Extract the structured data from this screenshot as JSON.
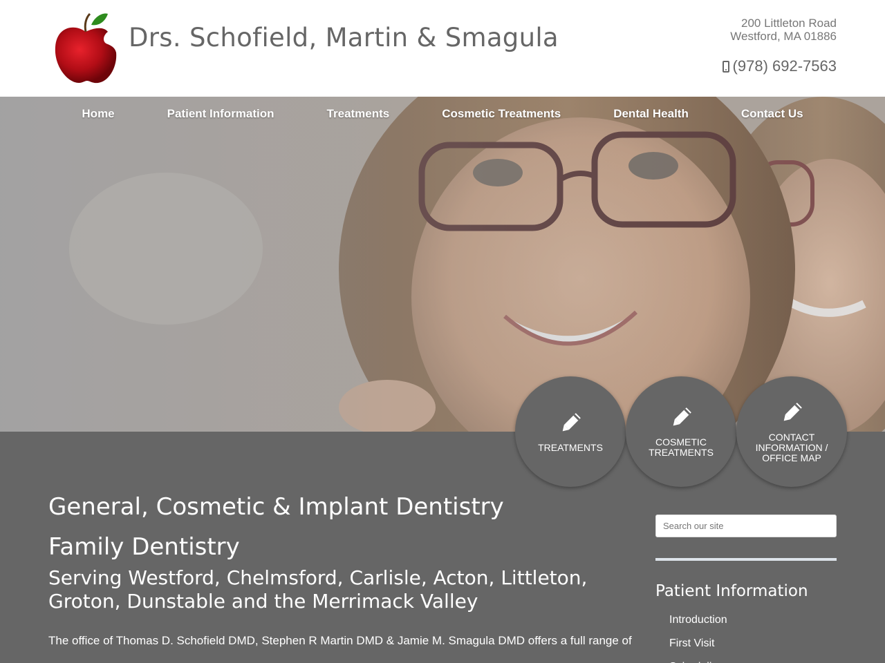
{
  "header": {
    "title": "Drs. Schofield, Martin & Smagula",
    "address_line1": "200 Littleton Road",
    "address_line2": "Westford, MA 01886",
    "phone": "(978) 692-7563"
  },
  "nav": {
    "items": [
      {
        "label": "Home"
      },
      {
        "label": "Patient Information"
      },
      {
        "label": "Treatments"
      },
      {
        "label": "Cosmetic Treatments"
      },
      {
        "label": "Dental Health"
      },
      {
        "label": "Contact Us"
      }
    ]
  },
  "circles": [
    {
      "label": "TREATMENTS",
      "icon": "pencil-icon"
    },
    {
      "label": "COSMETIC TREATMENTS",
      "icon": "pencil-icon"
    },
    {
      "label": "CONTACT INFORMATION / OFFICE MAP",
      "icon": "pencil-icon"
    }
  ],
  "main": {
    "heading1": "General, Cosmetic & Implant Dentistry",
    "heading2": "Family Dentistry",
    "heading3": "Serving Westford, Chelmsford, Carlisle, Acton, Littleton, Groton, Dunstable and the Merrimack Valley",
    "intro": "The office of Thomas D. Schofield DMD, Stephen R Martin DMD & Jamie M. Smagula DMD offers a full range of"
  },
  "sidebar": {
    "search_placeholder": "Search our site",
    "heading": "Patient Information",
    "items": [
      {
        "label": "Introduction"
      },
      {
        "label": "First Visit"
      },
      {
        "label": "Scheduling"
      }
    ]
  },
  "colors": {
    "brand_gray": "#666666",
    "logo_red": "#c0101a",
    "leaf_green": "#2e8b1e"
  }
}
